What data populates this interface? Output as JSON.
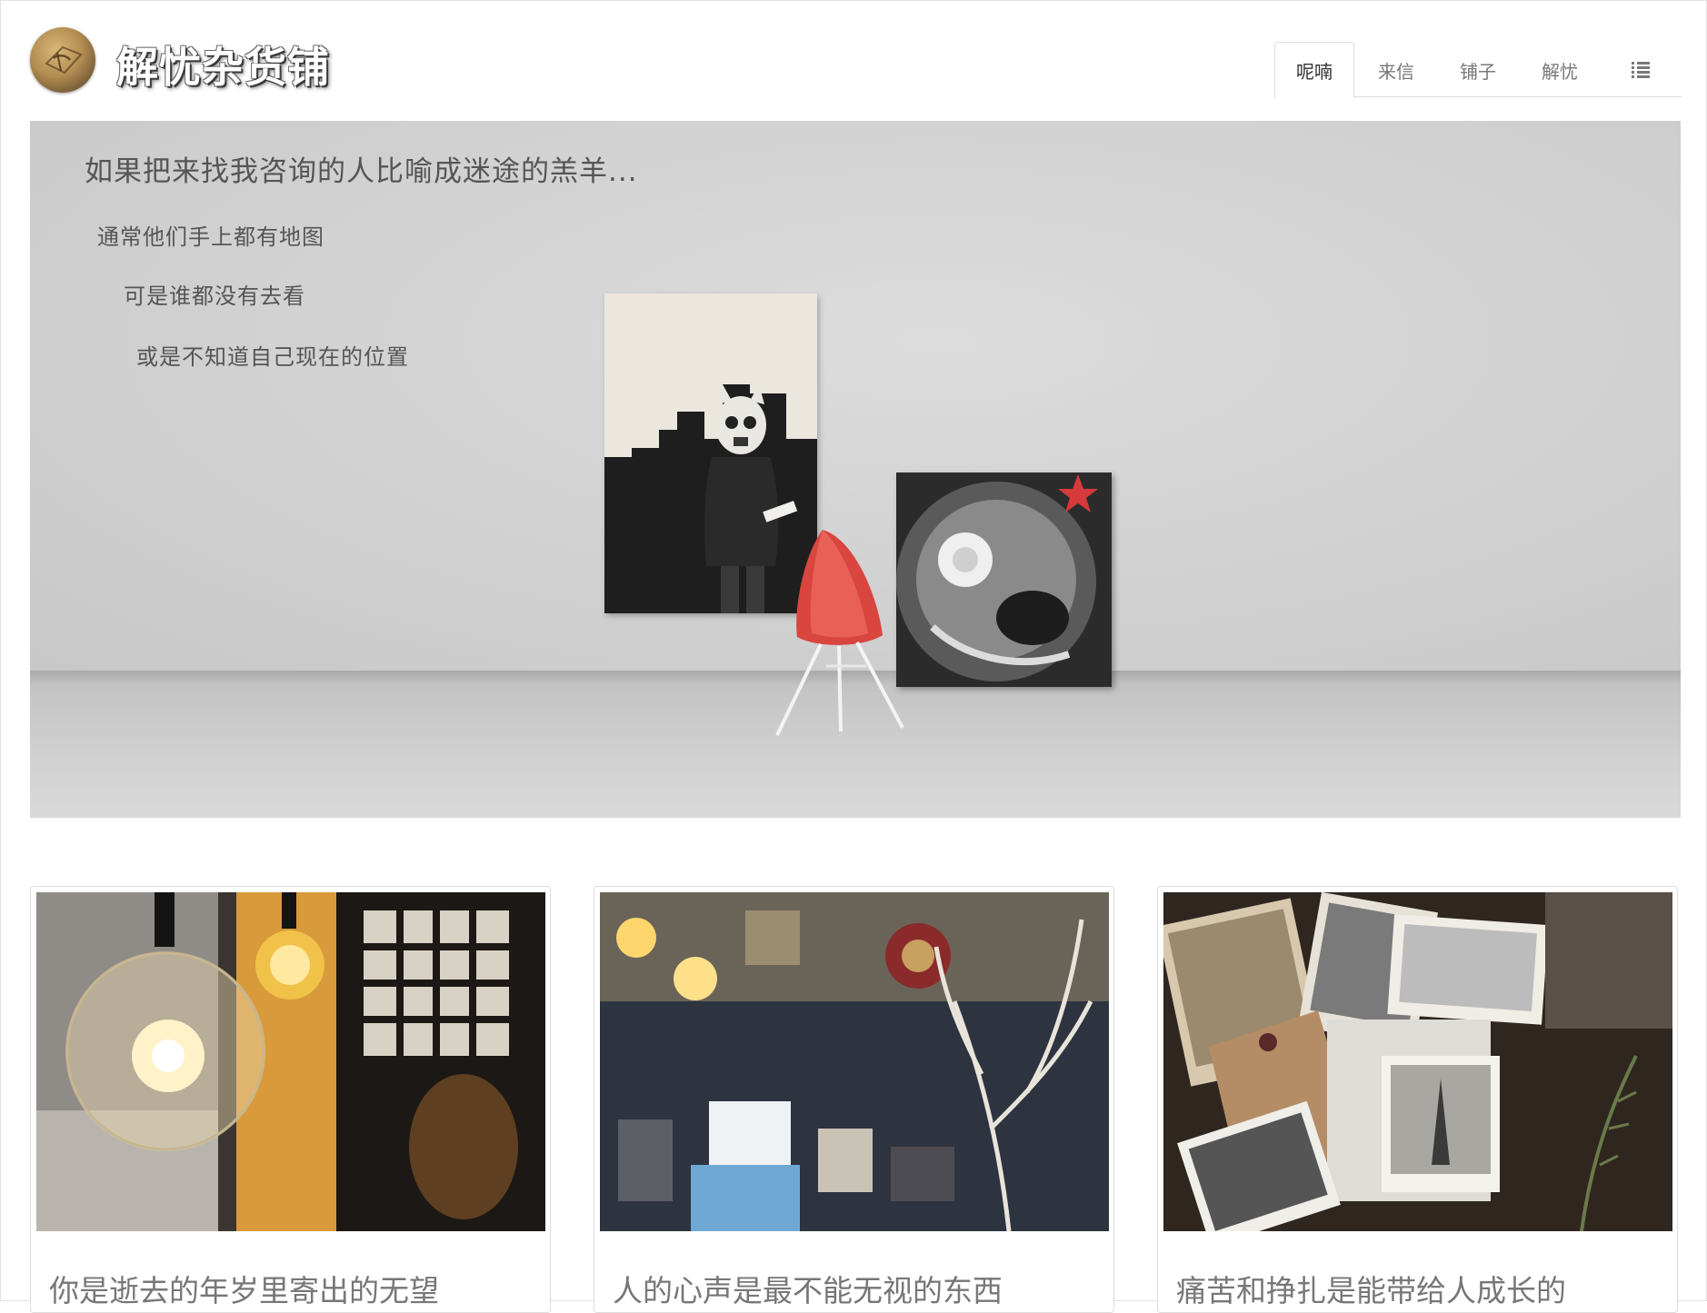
{
  "site": {
    "name": "解忧杂货铺"
  },
  "nav": {
    "items": [
      {
        "label": "呢喃",
        "active": true
      },
      {
        "label": "来信",
        "active": false
      },
      {
        "label": "铺子",
        "active": false
      },
      {
        "label": "解忧",
        "active": false
      }
    ],
    "menu_icon": "list-icon"
  },
  "hero": {
    "title": "如果把来找我咨询的人比喻成迷途的羔羊...",
    "lines": [
      "通常他们手上都有地图",
      "可是谁都没有去看",
      "或是不知道自己现在的位置"
    ]
  },
  "cards": [
    {
      "title": "你是逝去的年岁里寄出的无望",
      "image": "light-bulb-photo"
    },
    {
      "title": "人的心声是最不能无视的东西",
      "image": "shop-interior-photo"
    },
    {
      "title": "痛苦和挣扎是能带给人成长的",
      "image": "vintage-photos-photo"
    }
  ],
  "colors": {
    "text_gray": "#777777",
    "hero_text": "#555555",
    "chair_red": "#e0524a",
    "border": "#dddddd"
  }
}
